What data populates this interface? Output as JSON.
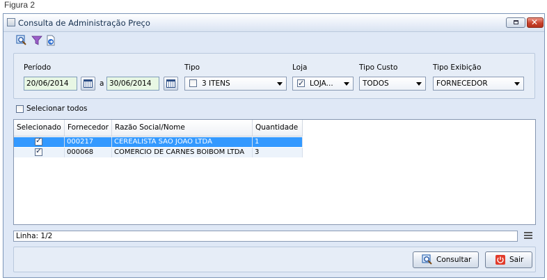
{
  "caption": "Figura 2",
  "window": {
    "title": "Consulta de Administração Preço",
    "restore_label": "",
    "close_label": "✕"
  },
  "toolbar": {
    "icons": [
      "search-icon",
      "filter-icon",
      "export-icon"
    ]
  },
  "filters": {
    "periodo_label": "Período",
    "date_from": "20/06/2014",
    "date_sep": "a",
    "date_to": "30/06/2014",
    "tipo_label": "Tipo",
    "tipo_value": "3 ITENS",
    "tipo_checked": false,
    "loja_label": "Loja",
    "loja_value": "LOJA...",
    "loja_checked": true,
    "tipo_custo_label": "Tipo Custo",
    "tipo_custo_value": "TODOS",
    "tipo_exibicao_label": "Tipo Exibição",
    "tipo_exibicao_value": "FORNECEDOR"
  },
  "select_all": {
    "label": "Selecionar todos",
    "checked": false
  },
  "grid": {
    "columns": [
      "Selecionado",
      "Fornecedor",
      "Razão Social/Nome",
      "Quantidade"
    ],
    "rows": [
      {
        "selected": true,
        "fornecedor": "000217",
        "razao": "CEREALISTA SAO JOAO LTDA",
        "quantidade": "1"
      },
      {
        "selected": true,
        "fornecedor": "000068",
        "razao": "COMERCIO DE CARNES BOIBOM LTDA",
        "quantidade": "3"
      }
    ]
  },
  "status": {
    "text": "Linha: 1/2"
  },
  "buttons": {
    "consultar": "Consultar",
    "sair": "Sair"
  },
  "colors": {
    "selection": "#3399ff",
    "window_bg": "#dfe8f6",
    "date_bg": "#e8f7e4"
  }
}
